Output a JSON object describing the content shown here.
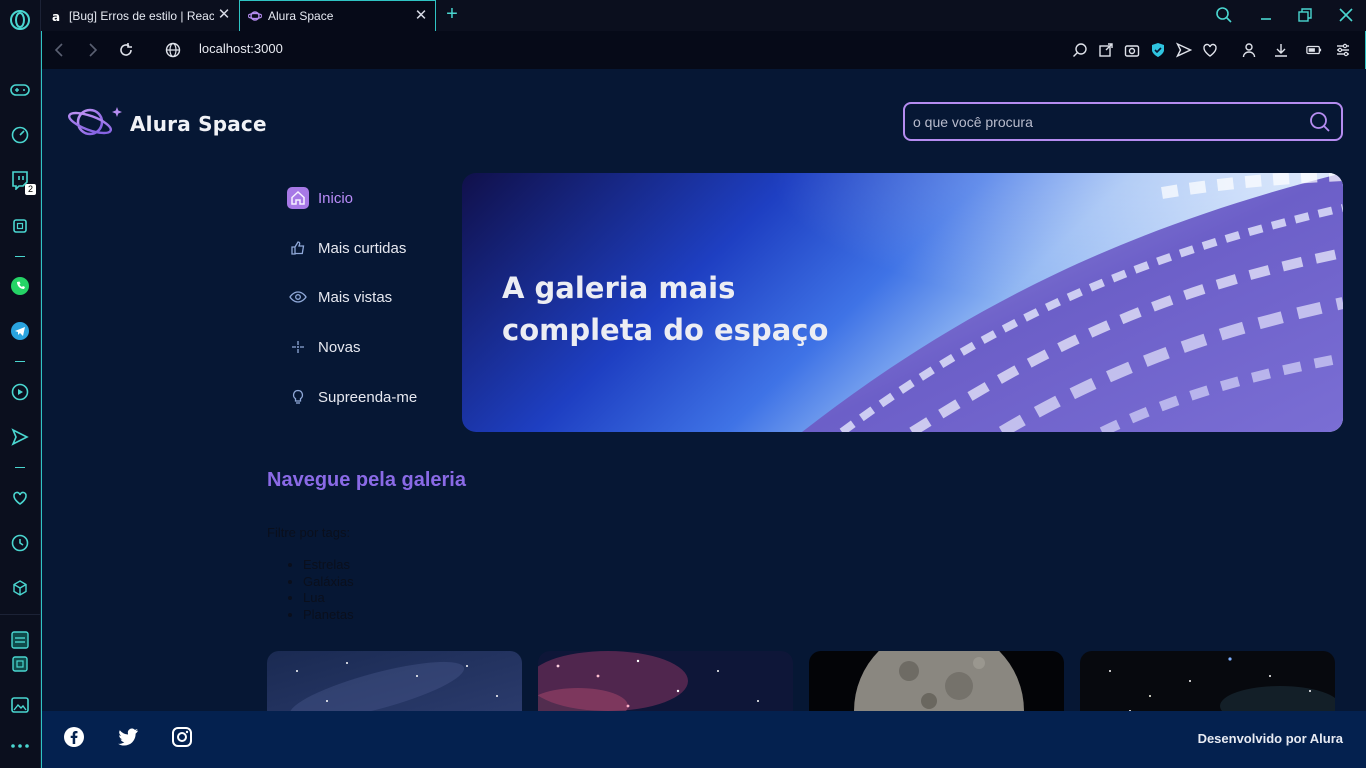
{
  "browser": {
    "tabs": [
      {
        "label": "[Bug] Erros de estilo | React",
        "close": "✕"
      },
      {
        "label": "Alura Space",
        "close": "✕"
      }
    ],
    "new_tab": "+",
    "url": "localhost:3000",
    "sidebar_badge": "2"
  },
  "header": {
    "logo_text": "Alura Space",
    "search_placeholder": "o que você procura"
  },
  "nav": {
    "items": [
      {
        "label": "Inicio",
        "icon": "home-icon",
        "active": true
      },
      {
        "label": "Mais curtidas",
        "icon": "thumbs-up-icon"
      },
      {
        "label": "Mais vistas",
        "icon": "eye-icon"
      },
      {
        "label": "Novas",
        "icon": "sparkle-icon"
      },
      {
        "label": "Supreenda-me",
        "icon": "lightbulb-icon"
      }
    ]
  },
  "banner": {
    "title": "A galeria mais completa do espaço"
  },
  "gallery": {
    "title": "Navegue pela galeria",
    "filter_label": "Filtre por tags:",
    "tags": [
      "Estrelas",
      "Galáxias",
      "Lua",
      "Planetas"
    ]
  },
  "footer": {
    "text": "Desenvolvido por Alura",
    "social": [
      "facebook-icon",
      "twitter-icon",
      "instagram-icon"
    ]
  },
  "colors": {
    "page_bg": "#061734",
    "accent": "#b98cf8",
    "footer_bg": "#04214f",
    "browser_accent": "#2fc4c4"
  }
}
